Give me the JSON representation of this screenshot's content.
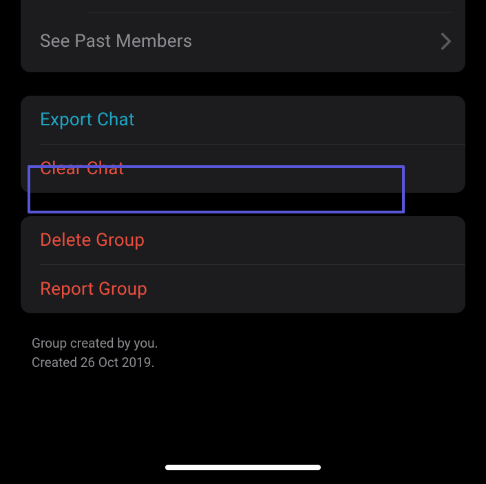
{
  "members_section": {
    "see_past_members": "See Past Members"
  },
  "chat_section": {
    "export_chat": "Export Chat",
    "clear_chat": "Clear Chat"
  },
  "group_section": {
    "delete_group": "Delete Group",
    "report_group": "Report Group"
  },
  "footer": {
    "line1": "Group created by you.",
    "line2": "Created 26 Oct 2019."
  }
}
